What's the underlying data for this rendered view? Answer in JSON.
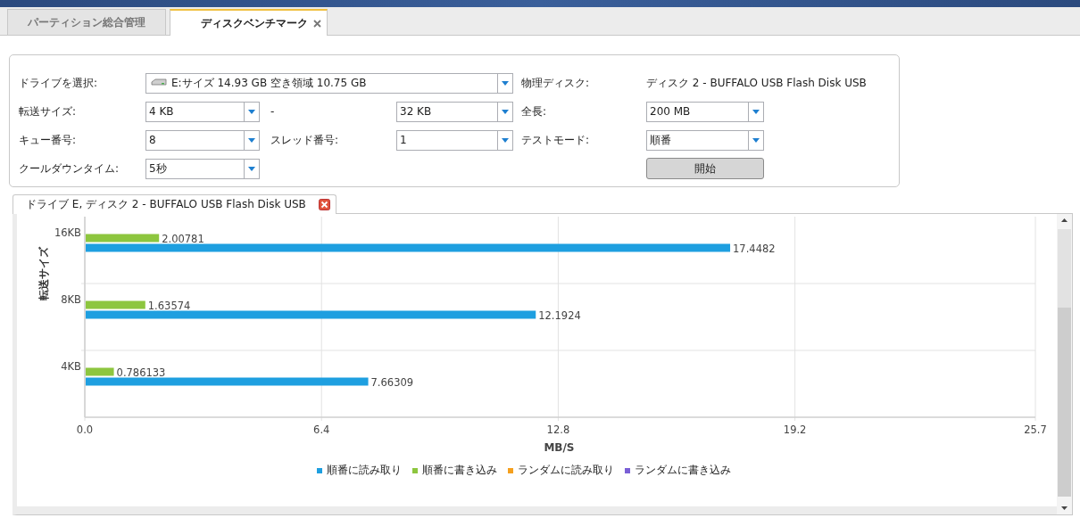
{
  "tabs": [
    {
      "label": "パーティション総合管理",
      "selected": false,
      "closable": false
    },
    {
      "label": "ディスクベンチマーク",
      "selected": true,
      "closable": true
    }
  ],
  "form": {
    "drive": {
      "label": "ドライブを選択:",
      "value": "E:サイズ 14.93 GB 空き領域 10.75 GB"
    },
    "physical_disk": {
      "label": "物理ディスク:",
      "value": "ディスク 2 - BUFFALO USB Flash Disk USB"
    },
    "transfer_size": {
      "label": "転送サイズ:",
      "from": "4 KB",
      "separator": "-",
      "to": "32 KB"
    },
    "total_length": {
      "label": "全長:",
      "value": "200 MB"
    },
    "queue_depth": {
      "label": "キュー番号:",
      "value": "8"
    },
    "threads": {
      "label": "スレッド番号:",
      "value": "1"
    },
    "test_mode": {
      "label": "テストモード:",
      "value": "順番"
    },
    "cooldown": {
      "label": "クールダウンタイム:",
      "value": "5秒"
    },
    "start_button": "開始"
  },
  "result_tab": {
    "label": "ドライブ E, ディスク 2 - BUFFALO USB Flash Disk USB",
    "closable": true
  },
  "chart_data": {
    "type": "bar",
    "orientation": "horizontal",
    "xlabel": "MB/S",
    "ylabel": "転送サイズ",
    "categories": [
      "16KB",
      "8KB",
      "4KB"
    ],
    "series": [
      {
        "name": "順番に読み取り",
        "color": "#1e9fe0",
        "values": [
          17.4482,
          12.1924,
          7.66309
        ]
      },
      {
        "name": "順番に書き込み",
        "color": "#8dc63f",
        "values": [
          2.00781,
          1.63574,
          0.786133
        ]
      },
      {
        "name": "ランダムに読み取り",
        "color": "#f5a01e",
        "values": [
          null,
          null,
          null
        ]
      },
      {
        "name": "ランダムに書き込み",
        "color": "#7a5fd6",
        "values": [
          null,
          null,
          null
        ]
      }
    ],
    "xlim": [
      0,
      25.7
    ],
    "xticks": [
      {
        "value": 0,
        "label": "0.0"
      },
      6.4,
      12.8,
      19.2,
      25.7
    ],
    "data_labels": true,
    "grid": true
  }
}
